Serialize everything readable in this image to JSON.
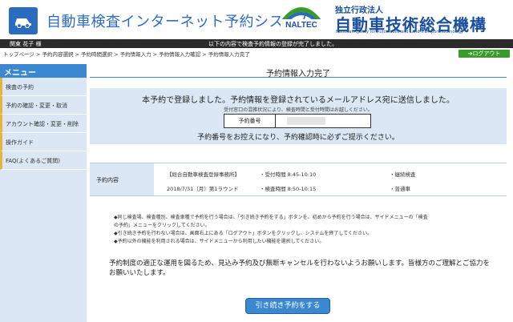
{
  "header": {
    "app_title": "自動車検査インターネット予約システム",
    "agency_subtitle": "独立行政法人",
    "agency_name": "自動車技術総合機構",
    "agency_english": "National Agency for Automobile and Land Transport Technology",
    "naltec_logo_text": "NALTEC",
    "brand_color": "#2e6bc4"
  },
  "infobar": {
    "user": "関東 花子 様",
    "notice": "以下の内容で検査予約情報の登録が完了しました。"
  },
  "breadcrumb": "トップページ > 予約内容選択 > 予約時間選択 > 予約情報入力 > 予約情報入力確認 > 予約情報入力完了",
  "logout_label": "ログアウト",
  "sidebar": {
    "heading": "メニュー",
    "items": [
      {
        "label": "検査の予約"
      },
      {
        "label": "予約の確認・変更・取消"
      },
      {
        "label": "アカウント確認・変更・削除"
      },
      {
        "label": "操作ガイド"
      },
      {
        "label": "FAQ(よくあるご質問)"
      }
    ]
  },
  "main": {
    "title": "予約情報入力完了",
    "message_main": "本予約で登録しました。予約情報を登録されているメールアドレス宛に送信しました。",
    "message_sub": "受付窓口の混雑状況により、検査時間と受付時間はお越しください。",
    "number_label": "予約番号",
    "message_foot": "予約番号をお控えになり、予約確認時に必ずご提示ください。",
    "detail": {
      "label": "予約内容",
      "row1_place": "【総合自動車検査登録事務所】",
      "row1_time": "・受付時間 8:45-10:10",
      "row1_type": "・継続検査",
      "row2_date": "2018/7/31（月）第1ラウンド",
      "row2_time": "・検査時間 8:50-10:15",
      "row2_type": "・普通車"
    },
    "notes": [
      "◆同じ検査場、検査種別、検査車種で予約を行う場合は、「引き続き予約をする」ボタンを、初めから予約を行う場合は、サイドメニューの「検査",
      "の予約」メニューをクリックしてください。",
      "◆引き続き予約を行わない場合は、画面右上にある「ログアウト」ボタンをクリックし、システムを終了してください。",
      "◆予約以外の機能を利用される場合は、サイドメニューから利用したい機能を選択してください。"
    ],
    "appeal": "予約制度の適正な運用を図るため、見込み予約及び無断キャンセルを行わないようお願いします。皆様方のご理解とご協力をお願いいたします。",
    "continue_button": "引き続き予約をする"
  }
}
